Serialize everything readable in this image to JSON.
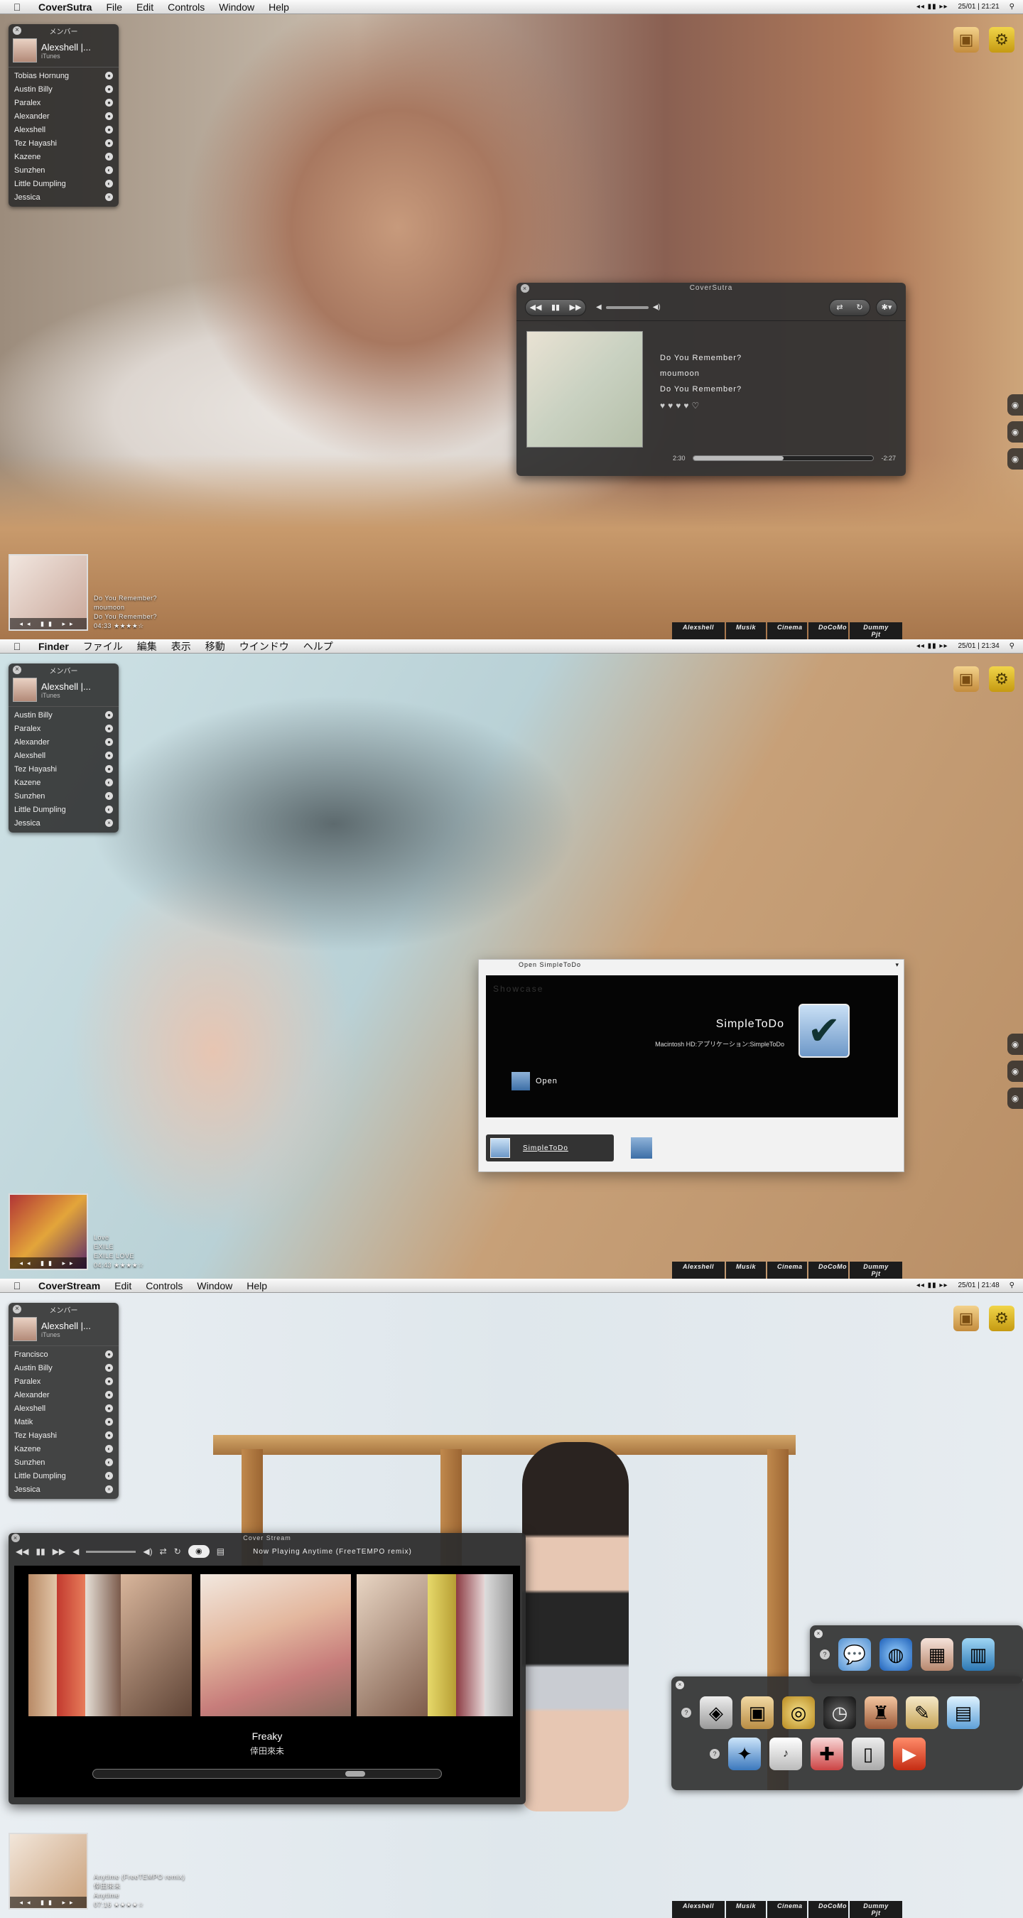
{
  "screens": [
    {
      "menubar": {
        "app": "CoverSutra",
        "menus": [
          "File",
          "Edit",
          "Controls",
          "Window",
          "Help"
        ],
        "controls": "◂◂ ▮▮ ▸▸",
        "clock": "25/01 | 21:21"
      },
      "members": {
        "title": "メンバー",
        "me": "Alexshell |...",
        "source": "iTunes",
        "list": [
          "Tobias Hornung",
          "Austin Billy",
          "Paralex",
          "Alexander",
          "Alexshell",
          "Tez Hayashi",
          "Kazene",
          "Sunzhen",
          "Little Dumpling",
          "Jessica"
        ]
      },
      "nowplaying": [
        "Do You Remember?",
        "moumoon",
        "Do You Remember?",
        "04:33 ★★★★☆"
      ],
      "coversutra": {
        "title": "CoverSutra",
        "song": "Do You Remember?",
        "artist": "moumoon",
        "album": "Do You Remember?",
        "elapsed": "2:30",
        "remaining": "-2:27",
        "progress": 0.5
      },
      "tabs": [
        "Alexshell",
        "Musik",
        "Cinema",
        "DoCoMo",
        "Dummy Pjt"
      ]
    },
    {
      "menubar": {
        "app": "Finder",
        "menus": [
          "ファイル",
          "編集",
          "表示",
          "移動",
          "ウインドウ",
          "ヘルプ"
        ],
        "controls": "◂◂ ▮▮ ▸▸",
        "clock": "25/01 | 21:34"
      },
      "members": {
        "title": "メンバー",
        "me": "Alexshell |...",
        "source": "iTunes",
        "list": [
          "Austin Billy",
          "Paralex",
          "Alexander",
          "Alexshell",
          "Tez Hayashi",
          "Kazene",
          "Sunzhen",
          "Little Dumpling",
          "Jessica"
        ]
      },
      "nowplaying": [
        "Love",
        "EXILE",
        "EXILE LOVE",
        "04:43 ★★★★☆"
      ],
      "simpletodo": {
        "title": "Open SimpleToDo",
        "showcase": "Showcase",
        "name": "SimpleToDo",
        "path": "Macintosh HD:アプリケーション:SimpleToDo",
        "open": "Open",
        "selected": "SimpleToDo"
      },
      "tabs": [
        "Alexshell",
        "Musik",
        "Cinema",
        "DoCoMo",
        "Dummy Pjt"
      ]
    },
    {
      "menubar": {
        "app": "CoverStream",
        "menus": [
          "Edit",
          "Controls",
          "Window",
          "Help"
        ],
        "controls": "◂◂ ▮▮ ▸▸",
        "clock": "25/01 | 21:48"
      },
      "members": {
        "title": "メンバー",
        "me": "Alexshell |...",
        "source": "iTunes",
        "list": [
          "Francisco",
          "Austin Billy",
          "Paralex",
          "Alexander",
          "Alexshell",
          "Matik",
          "Tez Hayashi",
          "Kazene",
          "Sunzhen",
          "Little Dumpling",
          "Jessica"
        ]
      },
      "nowplaying": [
        "Anytime (FreeTEMPO remix)",
        "倖田來未",
        "Anytime",
        "07:16 ★★★★☆"
      ],
      "coverstream": {
        "title": "Cover Stream",
        "now_playing": "Now Playing Anytime (FreeTEMPO remix)",
        "album": "Freaky",
        "artist": "倖田來未"
      },
      "tabs": [
        "Alexshell",
        "Musik",
        "Cinema",
        "DoCoMo",
        "Dummy Pjt"
      ]
    }
  ]
}
